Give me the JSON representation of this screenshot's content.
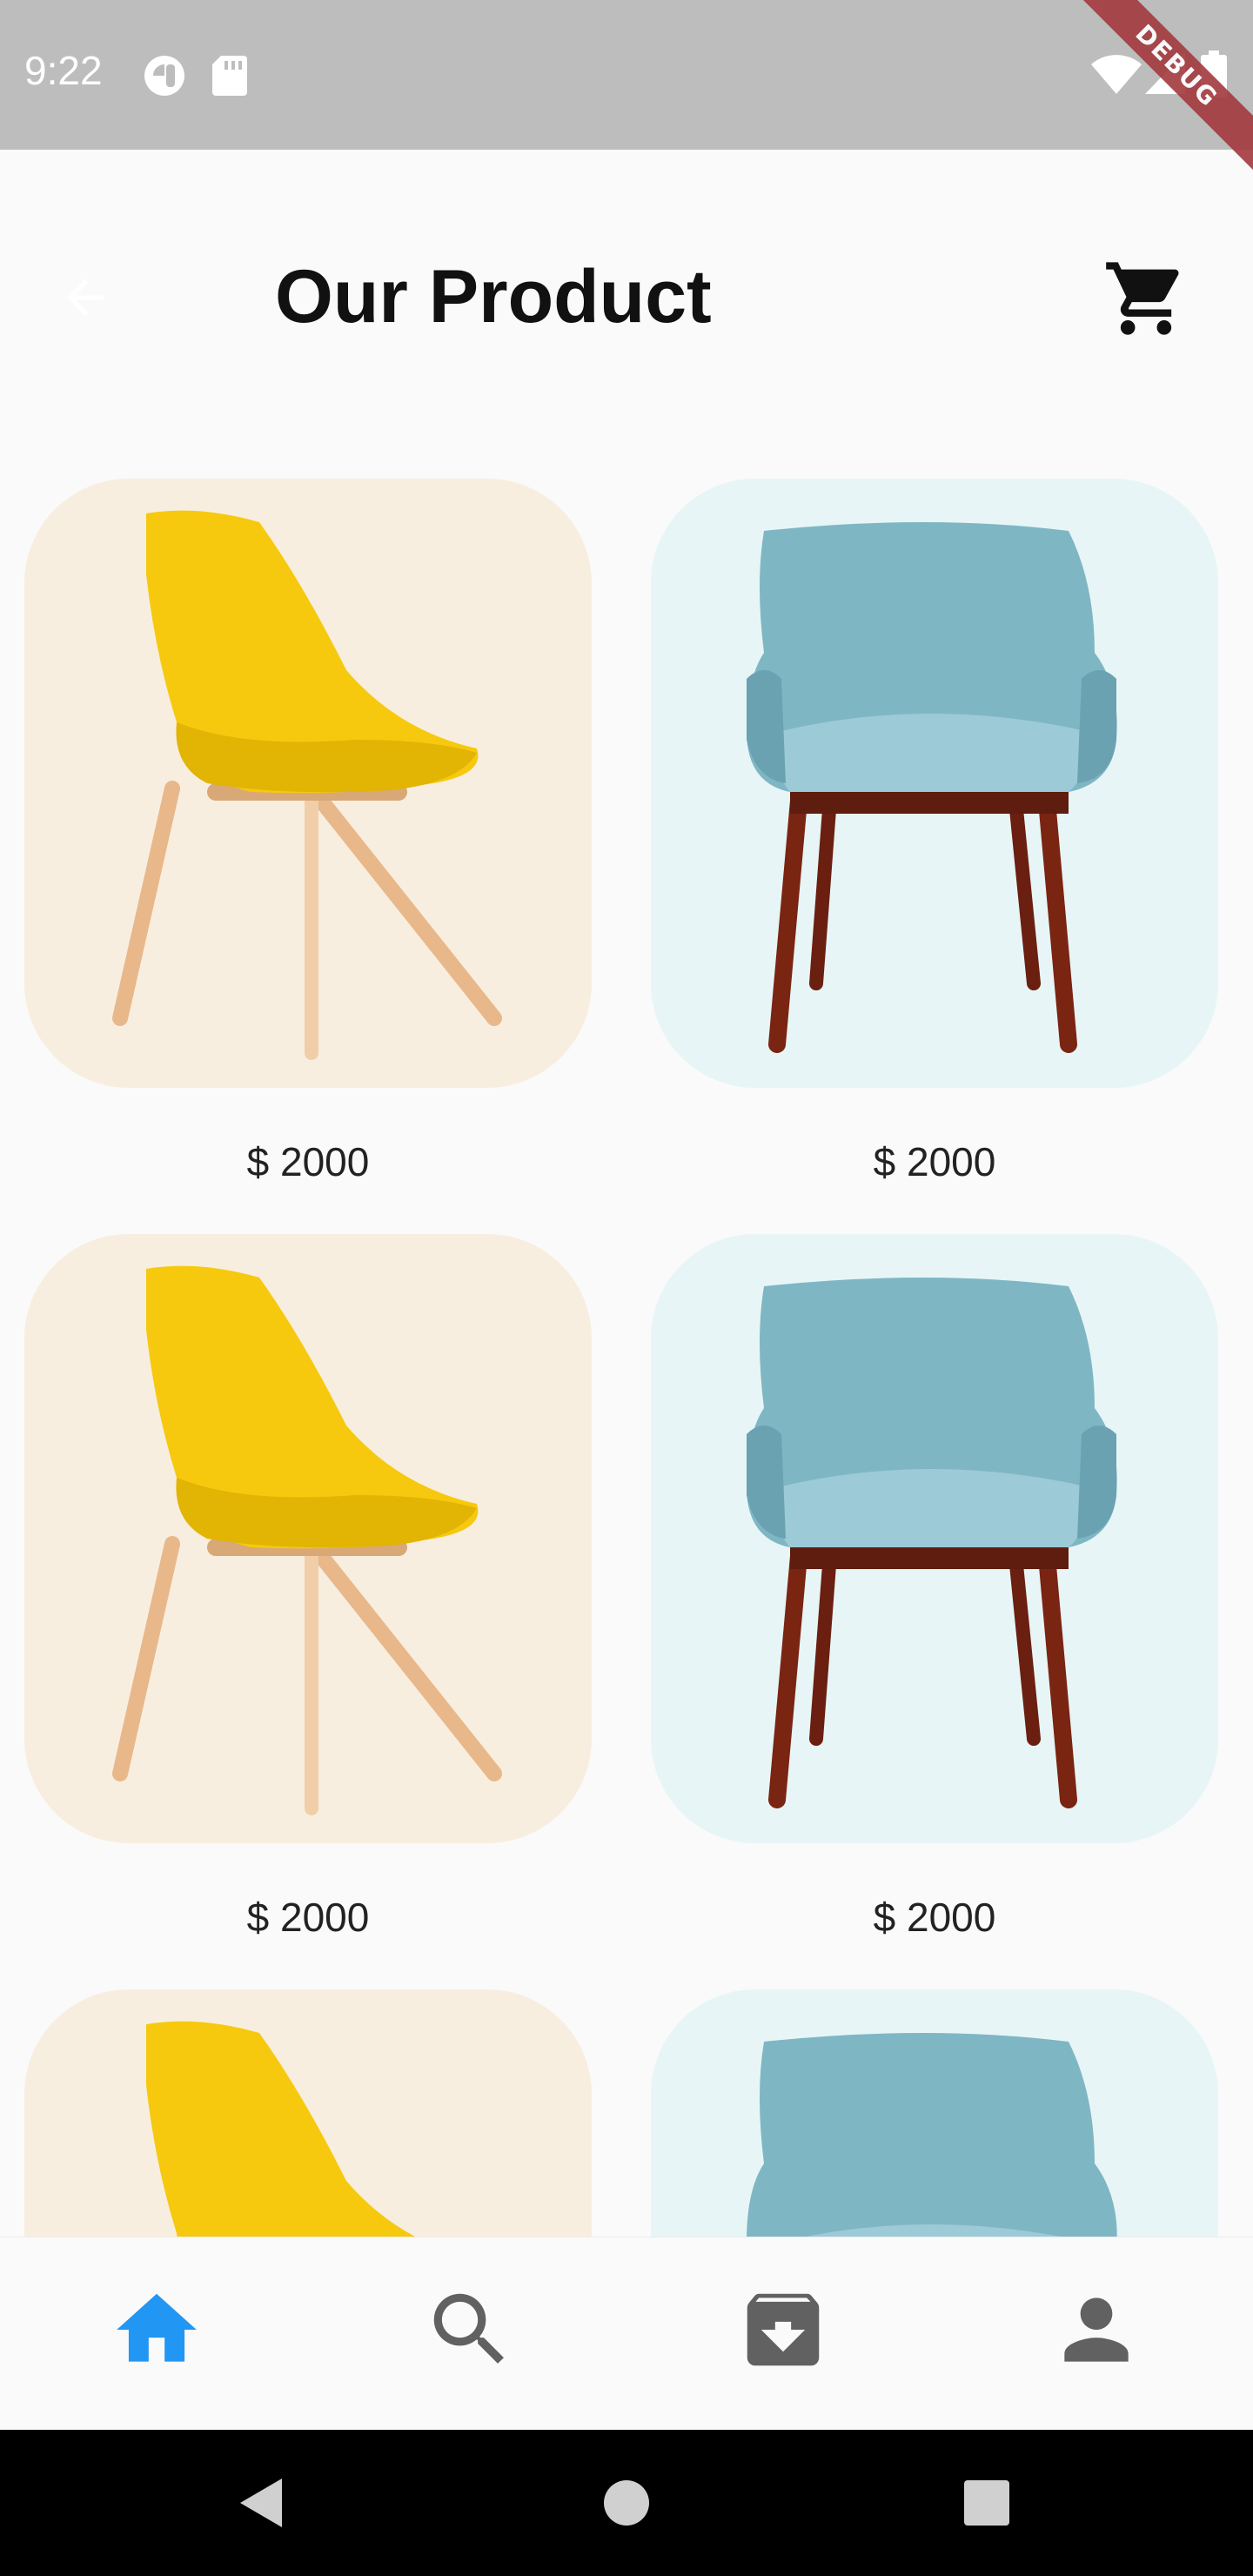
{
  "status_bar": {
    "time": "9:22",
    "icons": [
      "pill-notification-icon",
      "sd-card-icon",
      "wifi-icon",
      "signal-icon",
      "battery-icon"
    ],
    "debug_label": "DEBUG"
  },
  "app_bar": {
    "title": "Our Product",
    "back_icon": "arrow-back-icon",
    "cart_icon": "shopping-cart-icon"
  },
  "products": [
    {
      "price": "$ 2000",
      "image": "yellow-chair",
      "bg": "#f8eee0"
    },
    {
      "price": "$ 2000",
      "image": "teal-armchair",
      "bg": "#e7f5f6"
    },
    {
      "price": "$ 2000",
      "image": "yellow-chair",
      "bg": "#f8eee0"
    },
    {
      "price": "$ 2000",
      "image": "teal-armchair",
      "bg": "#e7f5f6"
    },
    {
      "price": "",
      "image": "yellow-chair",
      "bg": "#f8eee0"
    },
    {
      "price": "",
      "image": "teal-armchair",
      "bg": "#e7f5f6"
    }
  ],
  "bottom_nav": {
    "items": [
      {
        "icon": "home-icon",
        "active": true
      },
      {
        "icon": "search-icon",
        "active": false
      },
      {
        "icon": "archive-download-icon",
        "active": false
      },
      {
        "icon": "person-icon",
        "active": false
      }
    ],
    "active_color": "#2196f3",
    "inactive_color": "#616161"
  },
  "system_nav": {
    "icons": [
      "back-triangle-icon",
      "home-circle-icon",
      "recents-square-icon"
    ]
  }
}
